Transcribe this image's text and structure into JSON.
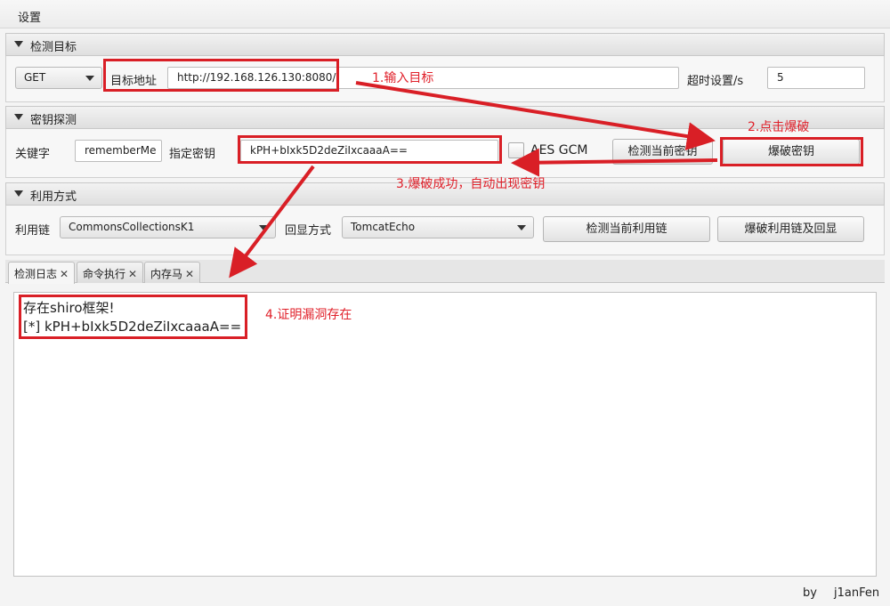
{
  "menu": {
    "settings": "设置"
  },
  "target_section": {
    "title": "检测目标",
    "method": "GET",
    "url_label": "目标地址",
    "url_value": "http://192.168.126.130:8080/",
    "timeout_label": "超时设置/s",
    "timeout_value": "5"
  },
  "key_section": {
    "title": "密钥探测",
    "keyword_label": "关键字",
    "keyword_value": "rememberMe",
    "key_label": "指定密钥",
    "key_value": "kPH+bIxk5D2deZiIxcaaaA==",
    "aes_gcm_label": "AES GCM",
    "check_key_button": "检测当前密钥",
    "brute_key_button": "爆破密钥"
  },
  "exploit_section": {
    "title": "利用方式",
    "chain_label": "利用链",
    "chain_value": "CommonsCollectionsK1",
    "echo_label": "回显方式",
    "echo_value": "TomcatEcho",
    "check_chain_button": "检测当前利用链",
    "brute_chain_button": "爆破利用链及回显"
  },
  "tabs": [
    {
      "label": "检测日志"
    },
    {
      "label": "命令执行"
    },
    {
      "label": "内存马"
    }
  ],
  "tab_close_glyph": "✕",
  "log_lines": [
    "存在shiro框架!",
    "[*] kPH+bIxk5D2deZiIxcaaaA=="
  ],
  "annotations": {
    "step1": "1.输入目标",
    "step2": "2.点击爆破",
    "step3": "3.爆破成功，自动出现密钥",
    "step4": "4.证明漏洞存在",
    "color": "#d91f26"
  },
  "footer": {
    "by": "by",
    "author": "j1anFen"
  }
}
